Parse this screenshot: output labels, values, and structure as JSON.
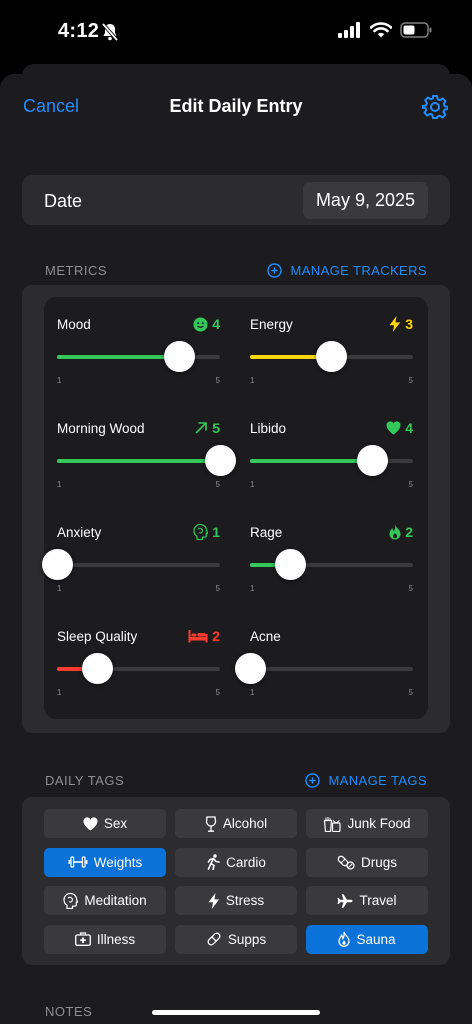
{
  "status_bar": {
    "time": "4:12"
  },
  "nav": {
    "cancel": "Cancel",
    "title": "Edit Daily Entry"
  },
  "date_row": {
    "label": "Date",
    "value": "May 9, 2025"
  },
  "metrics_section": {
    "header": "METRICS",
    "action": "MANAGE TRACKERS"
  },
  "metrics": [
    {
      "name": "Mood",
      "value": "4",
      "level": 4,
      "min": "1",
      "max": "5",
      "color": "#34c759",
      "icon": "smiley-icon",
      "icon_color": "#34c759"
    },
    {
      "name": "Energy",
      "value": "3",
      "level": 3,
      "min": "1",
      "max": "5",
      "color": "#ffd60a",
      "icon": "bolt-icon",
      "icon_color": "#ffd60a"
    },
    {
      "name": "Morning Wood",
      "value": "5",
      "level": 5,
      "min": "1",
      "max": "5",
      "color": "#34c759",
      "icon": "arrow-up-right-icon",
      "icon_color": "#34c759"
    },
    {
      "name": "Libido",
      "value": "4",
      "level": 4,
      "min": "1",
      "max": "5",
      "color": "#34c759",
      "icon": "heart-icon",
      "icon_color": "#34c759"
    },
    {
      "name": "Anxiety",
      "value": "1",
      "level": 1,
      "min": "1",
      "max": "5",
      "color": "#34c759",
      "icon": "head-icon",
      "icon_color": "#34c759"
    },
    {
      "name": "Rage",
      "value": "2",
      "level": 2,
      "min": "1",
      "max": "5",
      "color": "#34c759",
      "icon": "flame-icon",
      "icon_color": "#34c759"
    },
    {
      "name": "Sleep Quality",
      "value": "2",
      "level": 2,
      "min": "1",
      "max": "5",
      "color": "#ff3b30",
      "icon": "bed-icon",
      "icon_color": "#ff3b30"
    },
    {
      "name": "Acne",
      "value": "",
      "level": 1,
      "min": "1",
      "max": "5",
      "color": "#34c759",
      "icon": "",
      "icon_color": ""
    }
  ],
  "tags_section": {
    "header": "DAILY TAGS",
    "action": "MANAGE TAGS"
  },
  "tags": [
    {
      "label": "Sex",
      "icon": "heart-icon",
      "selected": false
    },
    {
      "label": "Alcohol",
      "icon": "wine-glass-icon",
      "selected": false
    },
    {
      "label": "Junk Food",
      "icon": "takeout-icon",
      "selected": false
    },
    {
      "label": "Weights",
      "icon": "dumbbell-icon",
      "selected": true
    },
    {
      "label": "Cardio",
      "icon": "running-icon",
      "selected": false
    },
    {
      "label": "Drugs",
      "icon": "pills-icon",
      "selected": false
    },
    {
      "label": "Meditation",
      "icon": "head-icon",
      "selected": false
    },
    {
      "label": "Stress",
      "icon": "bolt-icon",
      "selected": false
    },
    {
      "label": "Travel",
      "icon": "airplane-icon",
      "selected": false
    },
    {
      "label": "Illness",
      "icon": "medkit-icon",
      "selected": false
    },
    {
      "label": "Supps",
      "icon": "pill-icon",
      "selected": false
    },
    {
      "label": "Sauna",
      "icon": "drop-flame-icon",
      "selected": true
    }
  ],
  "notes_section": {
    "header": "NOTES"
  },
  "colors": {
    "accent": "#1f8cff",
    "tag_selected": "#0a72d8",
    "green": "#34c759",
    "yellow": "#ffd60a",
    "red": "#ff3b30"
  }
}
